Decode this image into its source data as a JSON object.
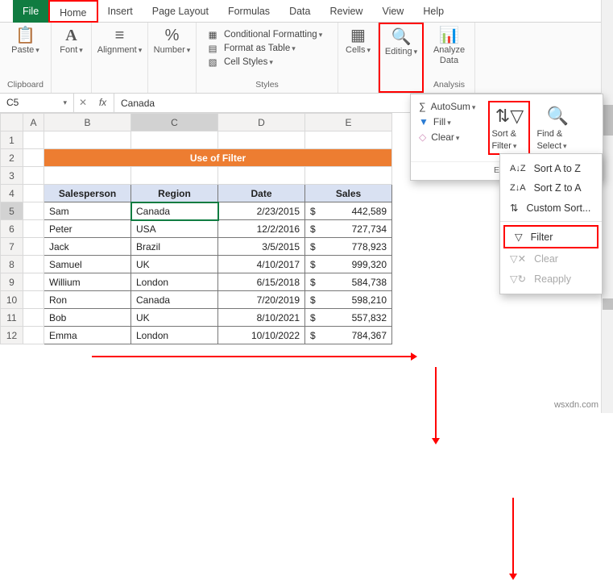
{
  "tabs": {
    "file": "File",
    "home": "Home",
    "insert": "Insert",
    "page_layout": "Page Layout",
    "formulas": "Formulas",
    "data": "Data",
    "review": "Review",
    "view": "View",
    "help": "Help"
  },
  "ribbon": {
    "clipboard": {
      "paste": "Paste",
      "label": "Clipboard"
    },
    "font": {
      "btn": "Font"
    },
    "alignment": {
      "btn": "Alignment"
    },
    "number": {
      "btn": "Number"
    },
    "styles": {
      "cond": "Conditional Formatting",
      "fat": "Format as Table",
      "cell": "Cell Styles",
      "label": "Styles"
    },
    "cells": {
      "btn": "Cells"
    },
    "editing": {
      "btn": "Editing"
    },
    "analysis": {
      "btn": "Analyze Data",
      "label": "Analysis"
    }
  },
  "name_box": "C5",
  "formula_value": "Canada",
  "columns": [
    "A",
    "B",
    "C",
    "D",
    "E"
  ],
  "title": "Use of Filter",
  "headers": {
    "b": "Salesperson",
    "c": "Region",
    "d": "Date",
    "e": "Sales"
  },
  "rows": [
    {
      "n": "5",
      "b": "Sam",
      "c": "Canada",
      "d": "2/23/2015",
      "e": "442,589"
    },
    {
      "n": "6",
      "b": "Peter",
      "c": "USA",
      "d": "12/2/2016",
      "e": "727,734"
    },
    {
      "n": "7",
      "b": "Jack",
      "c": "Brazil",
      "d": "3/5/2015",
      "e": "778,923"
    },
    {
      "n": "8",
      "b": "Samuel",
      "c": "UK",
      "d": "4/10/2017",
      "e": "999,320"
    },
    {
      "n": "9",
      "b": "Willium",
      "c": "London",
      "d": "6/15/2018",
      "e": "584,738"
    },
    {
      "n": "10",
      "b": "Ron",
      "c": "Canada",
      "d": "7/20/2019",
      "e": "598,210"
    },
    {
      "n": "11",
      "b": "Bob",
      "c": "UK",
      "d": "8/10/2021",
      "e": "557,832"
    },
    {
      "n": "12",
      "b": "Emma",
      "c": "London",
      "d": "10/10/2022",
      "e": "784,367"
    }
  ],
  "editing_menu": {
    "autosum": "AutoSum",
    "fill": "Fill",
    "clear": "Clear",
    "sort_filter": "Sort & Filter",
    "find_select": "Find & Select",
    "label": "Editing"
  },
  "sort_menu": {
    "az": "Sort A to Z",
    "za": "Sort Z to A",
    "custom": "Custom Sort...",
    "filter": "Filter",
    "clear": "Clear",
    "reapply": "Reapply"
  },
  "watermark": "wsxdn.com"
}
